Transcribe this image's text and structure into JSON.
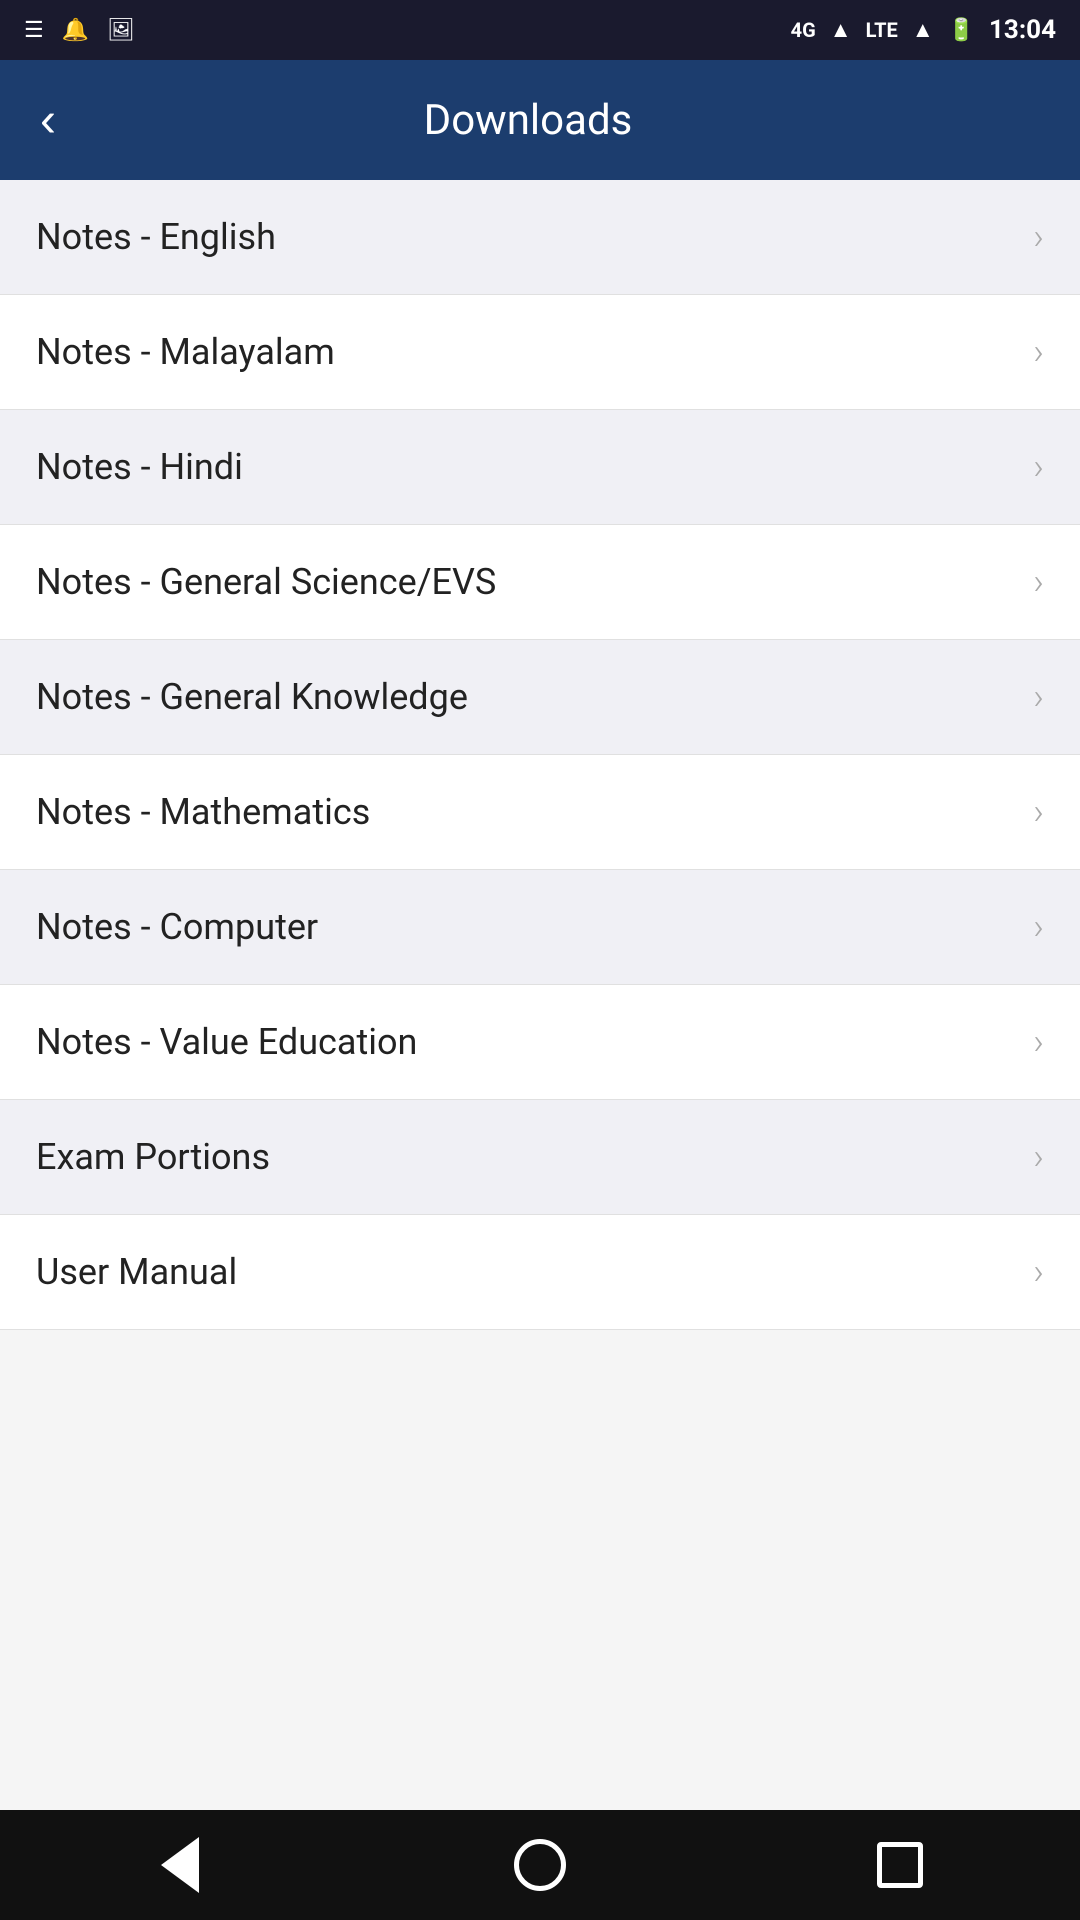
{
  "statusBar": {
    "time": "13:04",
    "networkType": "4G",
    "networkType2": "LTE"
  },
  "header": {
    "title": "Downloads",
    "backLabel": "‹"
  },
  "listItems": [
    {
      "id": 1,
      "label": "Notes - English"
    },
    {
      "id": 2,
      "label": "Notes - Malayalam"
    },
    {
      "id": 3,
      "label": "Notes - Hindi"
    },
    {
      "id": 4,
      "label": "Notes - General Science/EVS"
    },
    {
      "id": 5,
      "label": "Notes - General Knowledge"
    },
    {
      "id": 6,
      "label": "Notes - Mathematics"
    },
    {
      "id": 7,
      "label": "Notes - Computer"
    },
    {
      "id": 8,
      "label": "Notes - Value Education"
    },
    {
      "id": 9,
      "label": "Exam Portions"
    },
    {
      "id": 10,
      "label": "User Manual"
    }
  ],
  "bottomNav": {
    "backLabel": "back",
    "homeLabel": "home",
    "recentLabel": "recent"
  }
}
